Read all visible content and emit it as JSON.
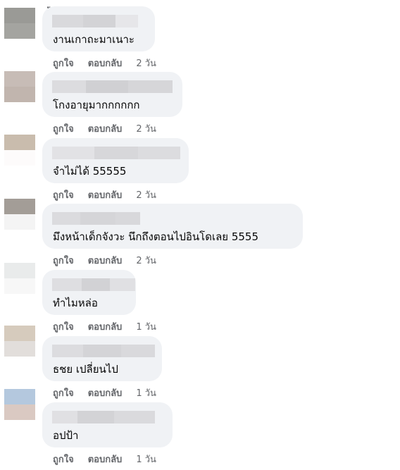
{
  "comments": [
    {
      "text": "งานเกาถะมาเนาะ",
      "like_label": "ถูกใจ",
      "reply_label": "ตอบกลับ",
      "time": "2 วัน",
      "avatar_colors": [
        "#9a9a96",
        "#a4a4a0"
      ],
      "blur_colors": [
        "#d9d9dc",
        "#d3d3d6",
        "#e6e6e9"
      ]
    },
    {
      "text": "โกงอายุมากกกกกก",
      "like_label": "ถูกใจ",
      "reply_label": "ตอบกลับ",
      "time": "2 วัน",
      "avatar_colors": [
        "#c7bcb6",
        "#c1b5ae"
      ],
      "blur_colors": [
        "#dcdcdf",
        "#d0d0d3",
        "#d6d6d9"
      ]
    },
    {
      "text": "จำไม่ได้ 55555",
      "like_label": "ถูกใจ",
      "reply_label": "ตอบกลับ",
      "time": "2 วัน",
      "avatar_colors": [
        "#c9bcad",
        "#fdfbfb"
      ],
      "blur_colors": [
        "#e2e2e5",
        "#d7d7da",
        "#dcdcdf"
      ]
    },
    {
      "text": "มึงหน้าเด็กจังวะ นึกถึงตอนไปอินโดเลย 5555",
      "like_label": "ถูกใจ",
      "reply_label": "ตอบกลับ",
      "time": "2 วัน",
      "avatar_colors": [
        "#a39d97",
        "#f4f4f4"
      ],
      "blur_colors": [
        "#dbdbde",
        "#d5d5d8",
        "#d8d8db"
      ]
    },
    {
      "text": "ทำไมหล่อ",
      "like_label": "ถูกใจ",
      "reply_label": "ตอบกลับ",
      "time": "1 วัน",
      "avatar_colors": [
        "#e9ebeb",
        "#f7f7f7"
      ],
      "blur_colors": [
        "#dedee1",
        "#d2d2d5",
        "#e0e0e3"
      ]
    },
    {
      "text": "ธชย เปลี่ยนไป",
      "like_label": "ถูกใจ",
      "reply_label": "ตอบกลับ",
      "time": "1 วัน",
      "avatar_colors": [
        "#d6cbbd",
        "#e2dedb"
      ],
      "blur_colors": [
        "#dcdcdf",
        "#d4d4d7",
        "#d9d9dc"
      ]
    },
    {
      "text": "อปป้า",
      "like_label": "ถูกใจ",
      "reply_label": "ตอบกลับ",
      "time": "1 วัน",
      "avatar_colors": [
        "#b4c8de",
        "#dac9c2"
      ],
      "blur_colors": [
        "#e0e0e3",
        "#d3d3d6",
        "#dadadd"
      ]
    }
  ]
}
